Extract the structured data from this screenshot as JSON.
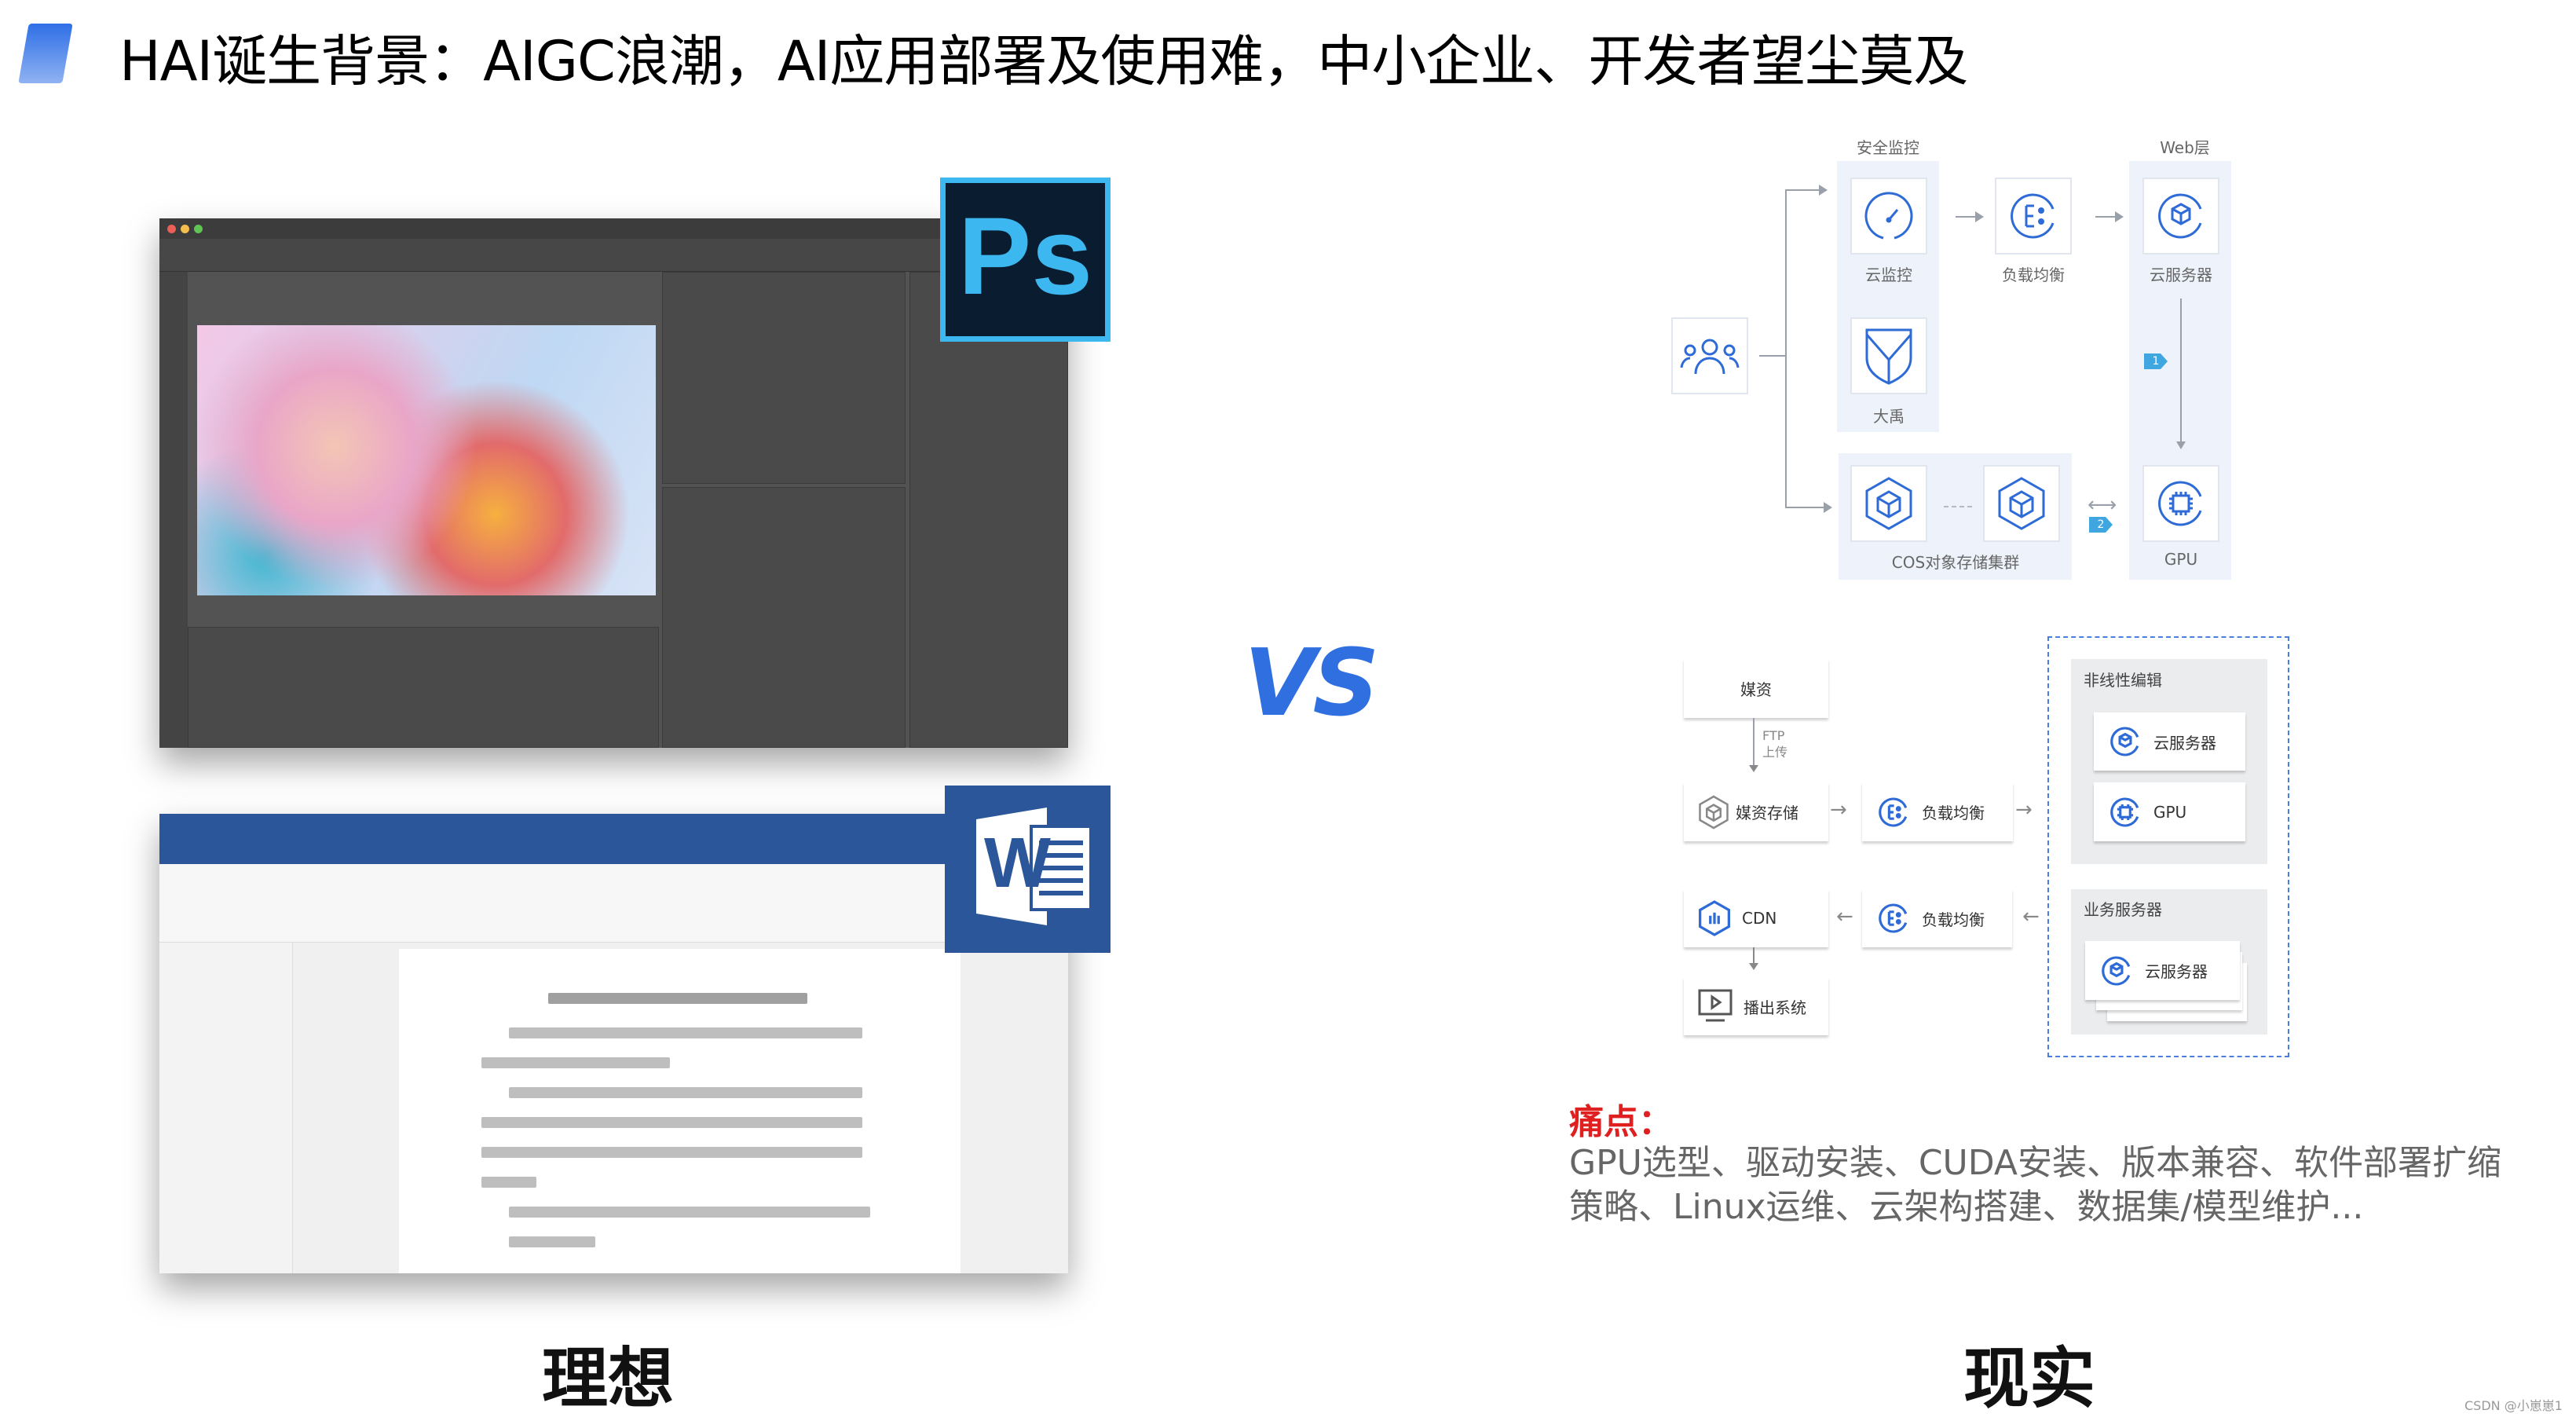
{
  "title": "HAI诞生背景：AIGC浪潮，AI应用部署及使用难，中小企业、开发者望尘莫及",
  "left": {
    "ps_logo": "Ps",
    "word_logo": "W",
    "caption": "理想"
  },
  "vs": "VS",
  "right": {
    "caption": "现实",
    "top_diagram": {
      "group_security": "安全监控",
      "group_web": "Web层",
      "cloud_monitor": "云监控",
      "load_balancer": "负载均衡",
      "cloud_server": "云服务器",
      "dayu": "大禹",
      "cos_cluster": "COS对象存储集群",
      "gpu": "GPU",
      "badge1": "1",
      "badge2": "2"
    },
    "bottom_diagram": {
      "media": "媒资",
      "ftp": "FTP",
      "upload": "上传",
      "media_storage": "媒资存储",
      "load_balancer_1": "负载均衡",
      "load_balancer_2": "负载均衡",
      "cdn": "CDN",
      "playout": "播出系统",
      "nonlinear_group": "非线性编辑",
      "nonlinear_server": "云服务器",
      "nonlinear_gpu": "GPU",
      "business_group": "业务服务器",
      "business_server": "云服务器"
    },
    "pain_title": "痛点：",
    "pain_line1": "GPU选型、驱动安装、CUDA安装、版本兼容、软件部署扩缩",
    "pain_line2": "策略、Linux运维、云架构搭建、数据集/模型维护..."
  },
  "watermark": "CSDN @小崽崽1",
  "colors": {
    "accent": "#2f6fe0",
    "icon_blue": "#2e6bd6",
    "pain_red": "#e02020",
    "ps_blue": "#3db7f0",
    "word_blue": "#2b579a"
  }
}
